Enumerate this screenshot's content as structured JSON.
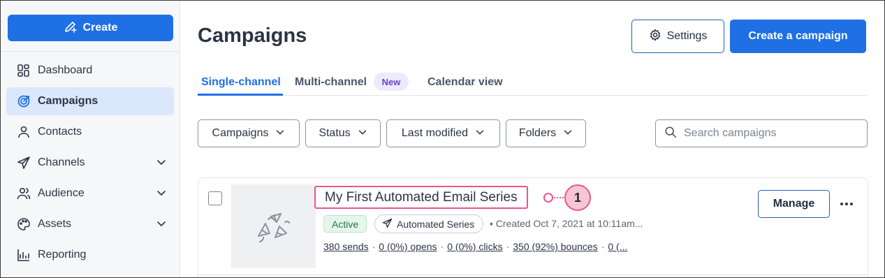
{
  "sidebar": {
    "create_label": "Create",
    "items": [
      {
        "label": "Dashboard",
        "icon": "dashboard-icon",
        "active": false,
        "expandable": false
      },
      {
        "label": "Campaigns",
        "icon": "target-icon",
        "active": true,
        "expandable": false
      },
      {
        "label": "Contacts",
        "icon": "person-icon",
        "active": false,
        "expandable": false
      },
      {
        "label": "Channels",
        "icon": "send-icon",
        "active": false,
        "expandable": true
      },
      {
        "label": "Audience",
        "icon": "audience-icon",
        "active": false,
        "expandable": true
      },
      {
        "label": "Assets",
        "icon": "palette-icon",
        "active": false,
        "expandable": true
      },
      {
        "label": "Reporting",
        "icon": "chart-icon",
        "active": false,
        "expandable": false
      }
    ]
  },
  "header": {
    "title": "Campaigns",
    "settings_label": "Settings",
    "create_campaign_label": "Create a campaign"
  },
  "tabs": {
    "single": "Single-channel",
    "multi": "Multi-channel",
    "new_badge": "New",
    "calendar": "Calendar view"
  },
  "filters": {
    "campaigns": "Campaigns",
    "status": "Status",
    "last_modified": "Last modified",
    "folders": "Folders",
    "search_placeholder": "Search campaigns"
  },
  "campaign": {
    "title": "My First Automated Email Series",
    "status": "Active",
    "type": "Automated Series",
    "created": "• Created Oct 7, 2021 at 10:11am...",
    "stats": {
      "sends": "380 sends",
      "opens": "0 (0%) opens",
      "clicks": "0 (0%) clicks",
      "bounces": "350 (92%) bounces",
      "more": "0 (..."
    },
    "manage_label": "Manage",
    "callout_number": "1"
  },
  "colors": {
    "primary": "#1f6fe5",
    "active_nav": "#dbe8fb",
    "callout": "#e8558c",
    "new_badge": "#6a3fd3"
  }
}
